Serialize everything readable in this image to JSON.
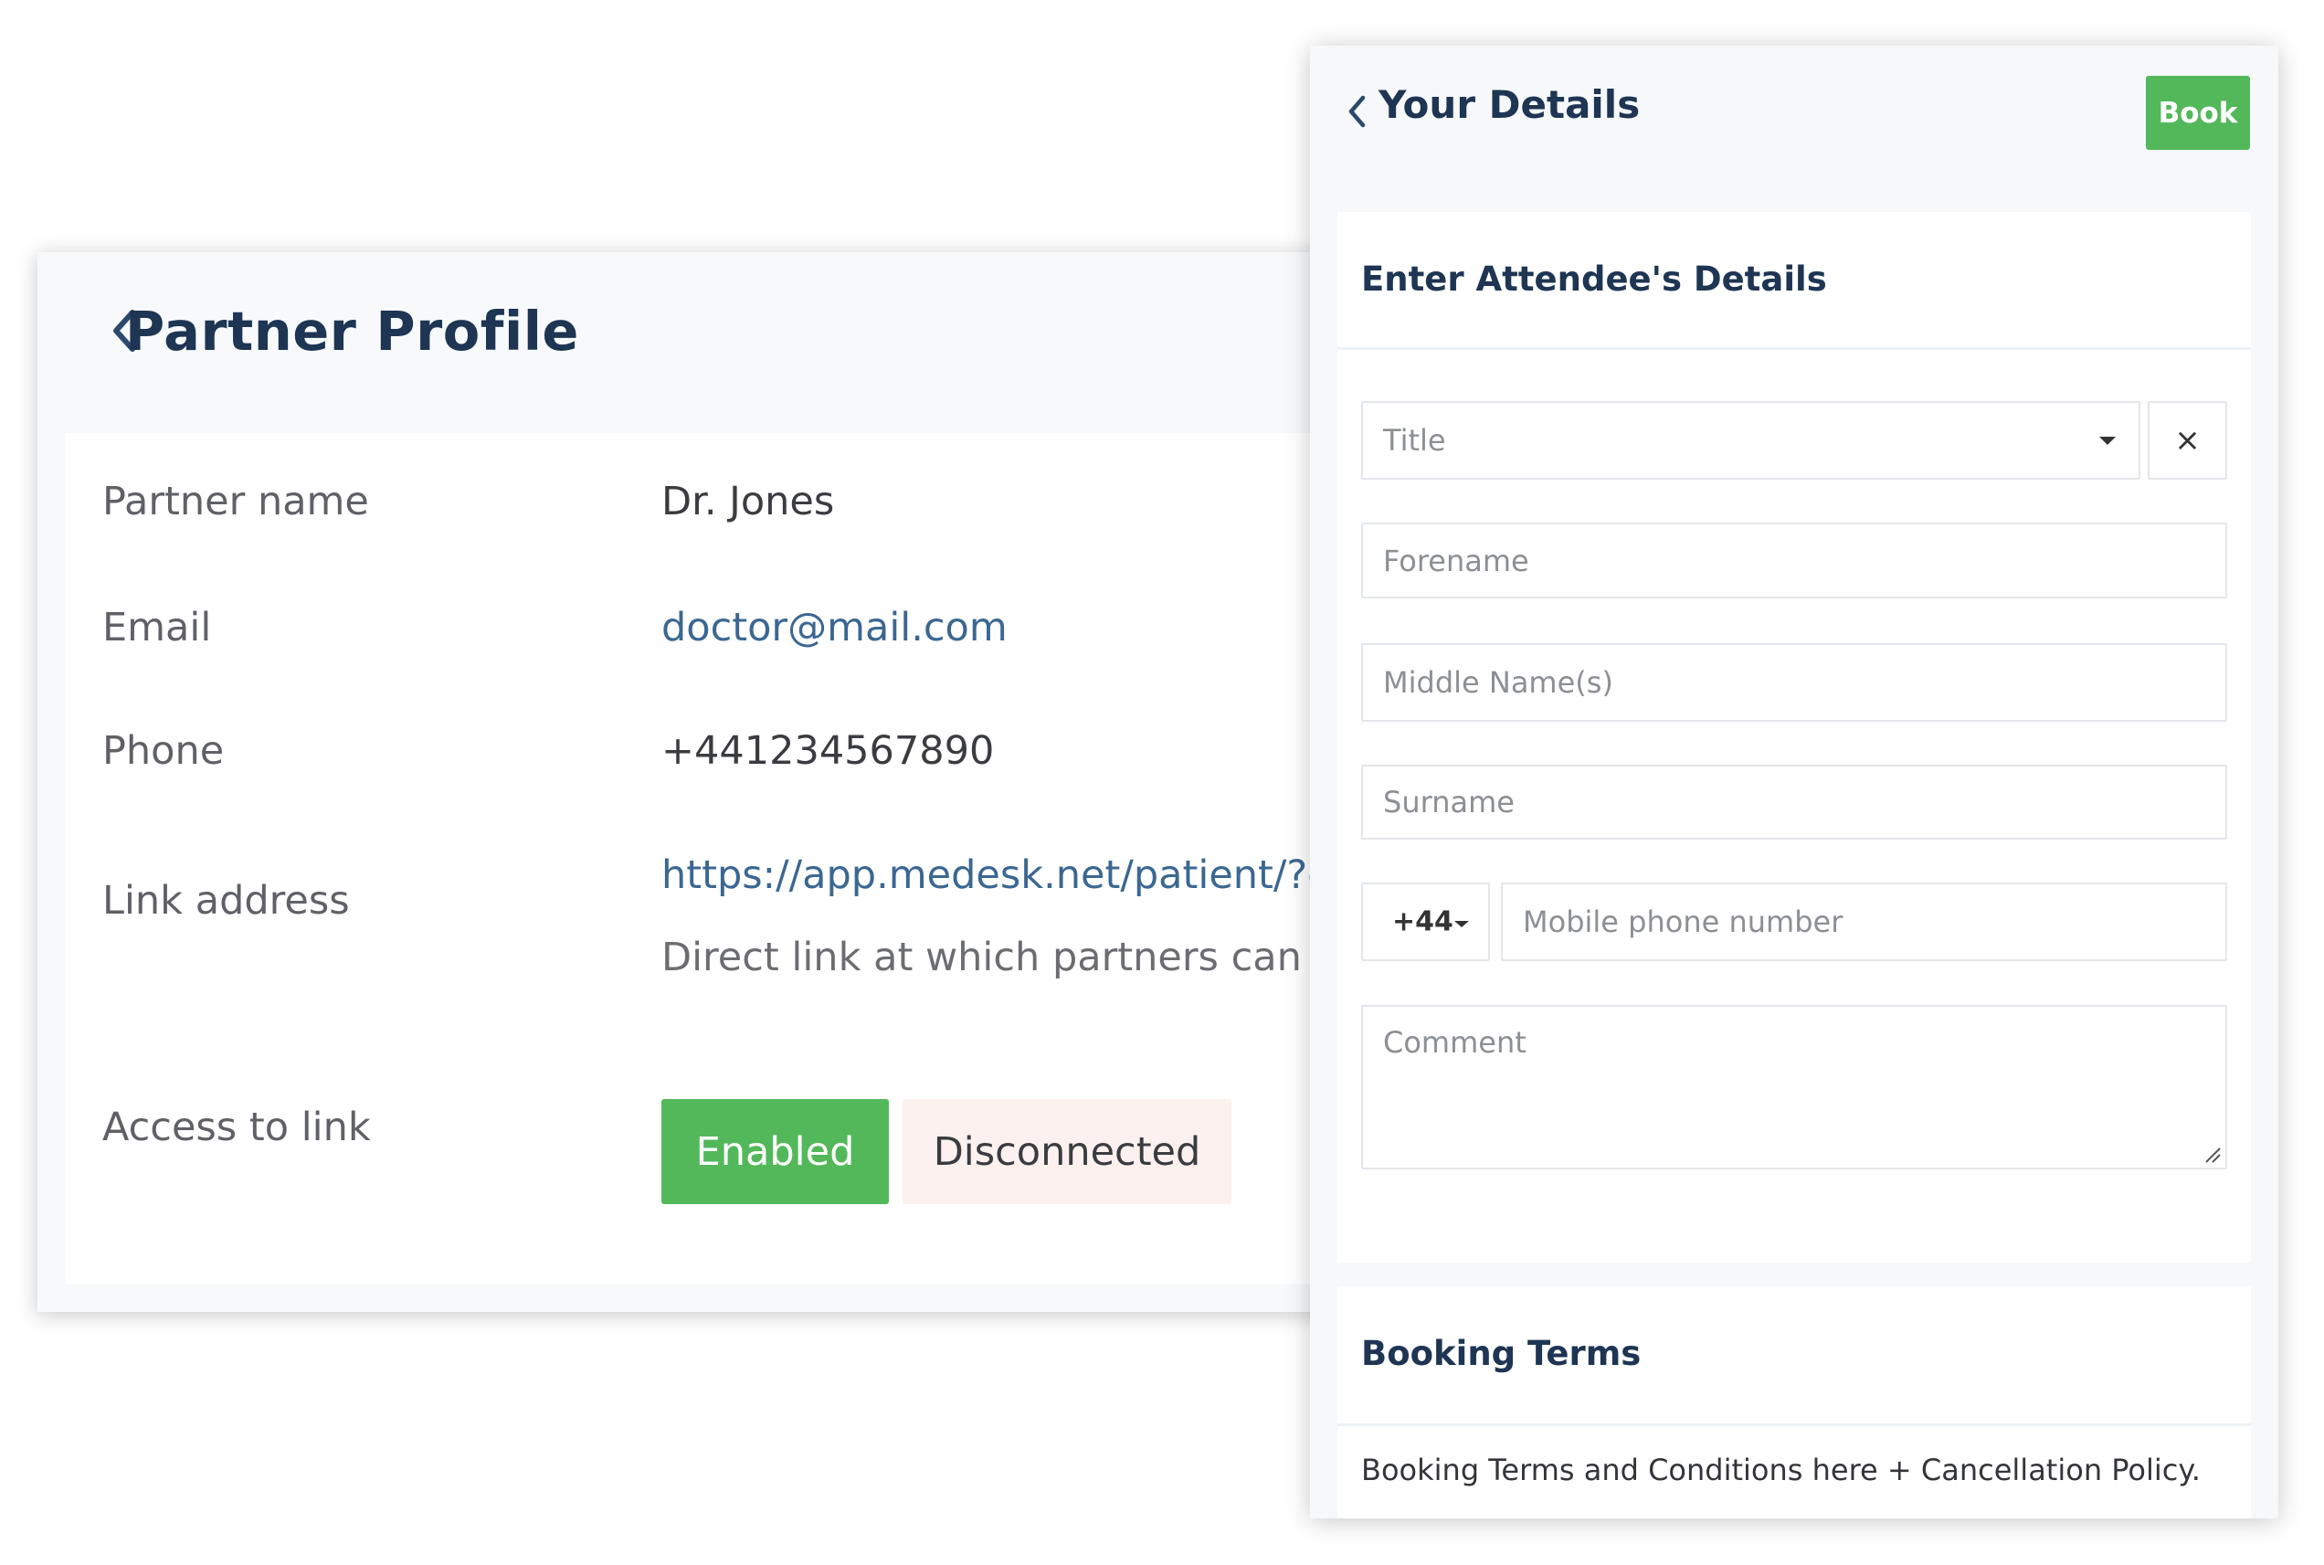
{
  "partner_profile": {
    "title": "Partner Profile",
    "fields": [
      {
        "label": "Partner name",
        "value": "Dr. Jones"
      },
      {
        "label": "Email",
        "value": "doctor@mail.com"
      },
      {
        "label": "Phone",
        "value": "+441234567890"
      },
      {
        "label": "Link address",
        "value": "https://app.medesk.net/patient/?c",
        "note": "Direct link at which partners can m"
      },
      {
        "label": "Access to link"
      }
    ],
    "access": {
      "enabled_label": "Enabled",
      "disconnected_label": "Disconnected",
      "selected": "Enabled"
    }
  },
  "your_details": {
    "title": "Your Details",
    "book_label": "Book",
    "attendee_section": {
      "title": "Enter Attendee's Details",
      "title_select": {
        "placeholder": "Title",
        "clear_symbol": "×"
      },
      "forename_placeholder": "Forename",
      "middle_name_placeholder": "Middle Name(s)",
      "surname_placeholder": "Surname",
      "phone_code": "+44",
      "phone_placeholder": "Mobile phone number",
      "comment_placeholder": "Comment"
    },
    "booking_terms": {
      "title": "Booking Terms",
      "text": "Booking Terms and Conditions here + Cancellation Policy."
    }
  },
  "colors": {
    "accent_green": "#53b85a",
    "heading_navy": "#1e3553",
    "link_blue": "#3b6792",
    "disconnected_bg": "#fcf1ef"
  },
  "icons": [
    "chevron-left-icon",
    "caret-down-icon",
    "close-icon",
    "resize-handle-icon"
  ]
}
